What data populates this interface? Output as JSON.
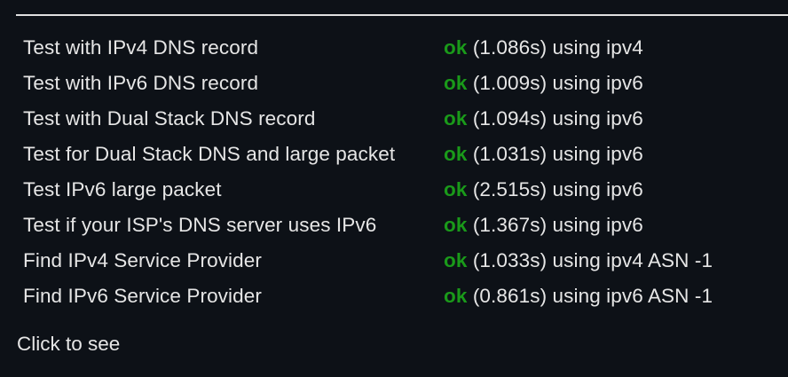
{
  "results": [
    {
      "test": "Test with IPv4 DNS record",
      "status": "ok",
      "detail": "(1.086s) using ipv4"
    },
    {
      "test": "Test with IPv6 DNS record",
      "status": "ok",
      "detail": "(1.009s) using ipv6"
    },
    {
      "test": "Test with Dual Stack DNS record",
      "status": "ok",
      "detail": "(1.094s) using ipv6"
    },
    {
      "test": "Test for Dual Stack DNS and large packet",
      "status": "ok",
      "detail": "(1.031s) using ipv6"
    },
    {
      "test": "Test IPv6 large packet",
      "status": "ok",
      "detail": "(2.515s) using ipv6"
    },
    {
      "test": "Test if your ISP's DNS server uses IPv6",
      "status": "ok",
      "detail": "(1.367s) using ipv6"
    },
    {
      "test": "Find IPv4 Service Provider",
      "status": "ok",
      "detail": "(1.033s) using ipv4 ASN -1"
    },
    {
      "test": "Find IPv6 Service Provider",
      "status": "ok",
      "detail": "(0.861s) using ipv6 ASN -1"
    }
  ],
  "footer": {
    "click_label": "Click to see"
  },
  "colors": {
    "background": "#0d1117",
    "ok": "#1a9a1a",
    "text": "#e6e6e6"
  }
}
